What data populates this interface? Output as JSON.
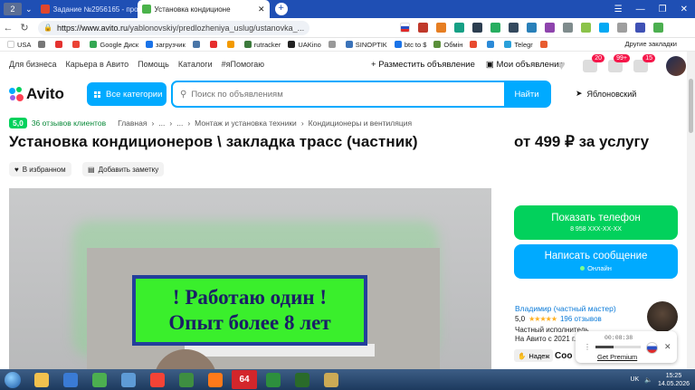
{
  "browser": {
    "tab_counter": "2",
    "tabs": [
      {
        "title": "Задание №2956165 - про",
        "color": "#e0462c"
      },
      {
        "title": "Установка кондиционе",
        "color": "#4bb34b"
      }
    ],
    "url_host": "https://www.avito.ru",
    "url_path": "/yablonovskiy/predlozheniya_uslug/ustanovka_..."
  },
  "bookmarks": {
    "items": [
      {
        "label": "USA",
        "color": "#ffffff"
      },
      {
        "label": "",
        "color": "#777777"
      },
      {
        "label": "",
        "color": "#e4322f"
      },
      {
        "label": "",
        "color": "#ea4335"
      },
      {
        "label": "Google Диск",
        "color": "#34a853"
      },
      {
        "label": "загрузчик",
        "color": "#1a73e8"
      },
      {
        "label": "",
        "color": "#4a76a8"
      },
      {
        "label": "",
        "color": "#e62e2e"
      },
      {
        "label": "",
        "color": "#f39a00"
      },
      {
        "label": "rutracker",
        "color": "#3c7a3c"
      },
      {
        "label": "UAKino",
        "color": "#222222"
      },
      {
        "label": "",
        "color": "#999999"
      },
      {
        "label": "SINOPTIK",
        "color": "#3b73b9"
      },
      {
        "label": "btc to $",
        "color": "#1a73e8"
      },
      {
        "label": "Обмін",
        "color": "#5a8f3a"
      },
      {
        "label": "",
        "color": "#e84a2f"
      },
      {
        "label": "",
        "color": "#2b8ad8"
      },
      {
        "label": "Telegr",
        "color": "#2aa0da"
      },
      {
        "label": "",
        "color": "#e85c2f"
      }
    ],
    "other": "Другие закладки"
  },
  "avito": {
    "topnav": [
      "Для бизнеса",
      "Карьера в Авито",
      "Помощь",
      "Каталоги",
      "#яПомогаю"
    ],
    "post_ad": "Разместить объявление",
    "my_ads": "Мои объявления",
    "badges": {
      "messages": "20",
      "notifications": "99+",
      "cart": "15"
    },
    "logo": "Avito",
    "all_categories": "Все категории",
    "search_placeholder": "Поиск по объявлениям",
    "search_button": "Найти",
    "location": "Яблоновский"
  },
  "listing": {
    "rating": "5,0",
    "reviews_count": "36 отзывов клиентов",
    "breadcrumb": [
      "Главная",
      "...",
      "...",
      "Монтаж и установка техники",
      "Кондиционеры и вентиляция"
    ],
    "title": "Установка кондиционеров \\ закладка трасс (частник)",
    "price": "от 499 ₽ за услугу",
    "fav_label": "В избранном",
    "note_label": "Добавить заметку",
    "photo_text_line1": "! Работаю один !",
    "photo_text_line2": "Опыт более 8 лет"
  },
  "contact": {
    "phone_title": "Показать телефон",
    "phone_masked": "8 958 XXX-XX-XX",
    "message_title": "Написать сообщение",
    "online": "Онлайн"
  },
  "seller": {
    "name": "Владимир (частный мастер)",
    "rating": "5,0",
    "stars": "★★★★★",
    "reviews": "196 отзывов",
    "type": "Частный исполнитель",
    "since": "На Авито с 2021 г.",
    "badge": "Надеж",
    "soo": "Соо"
  },
  "player": {
    "time": "00:08:38",
    "premium": "Get Premium"
  },
  "taskbar": {
    "apps": [
      {
        "name": "explorer-icon",
        "color": "#f2c14e",
        "label": ""
      },
      {
        "name": "shield-icon",
        "color": "#3a7bd5",
        "label": ""
      },
      {
        "name": "chrome-icon",
        "color": "#4caf50",
        "label": ""
      },
      {
        "name": "network-icon",
        "color": "#5e9bd6",
        "label": ""
      },
      {
        "name": "yandex-icon",
        "color": "#f44336",
        "label": ""
      },
      {
        "name": "monitor-icon",
        "color": "#3e8e41",
        "label": ""
      },
      {
        "name": "media-icon",
        "color": "#ff7a1a",
        "label": ""
      },
      {
        "name": "aida64-icon",
        "color": "#d3262b",
        "label": "64"
      },
      {
        "name": "office-icon",
        "color": "#2d8f3d",
        "label": ""
      },
      {
        "name": "terminal-icon",
        "color": "#2a6b2a",
        "label": ""
      },
      {
        "name": "files-icon",
        "color": "#ccaa55",
        "label": ""
      }
    ],
    "lang": "UK",
    "time": "15:25",
    "date": "14.05.2026"
  }
}
